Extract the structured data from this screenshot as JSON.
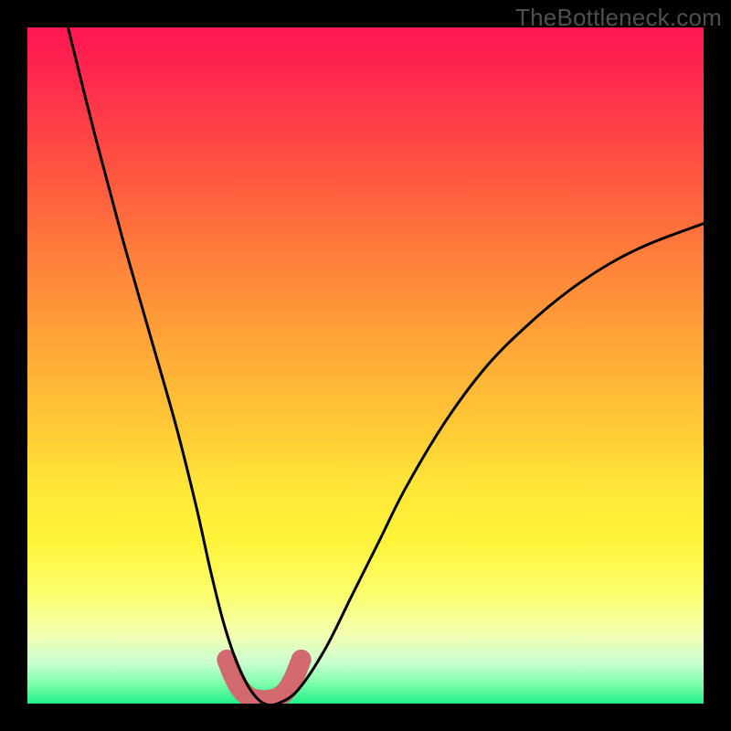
{
  "watermark": "TheBottleneck.com",
  "chart_data": {
    "type": "line",
    "title": "",
    "xlabel": "",
    "ylabel": "",
    "xlim": [
      0,
      100
    ],
    "ylim": [
      0,
      100
    ],
    "grid": false,
    "series": [
      {
        "name": "bottleneck-curve",
        "color": "#000000",
        "x": [
          6,
          10,
          14,
          18,
          22,
          25,
          27,
          29,
          31,
          33,
          35,
          37,
          40,
          44,
          48,
          52,
          56,
          62,
          68,
          74,
          80,
          86,
          92,
          100
        ],
        "values": [
          100,
          84,
          69,
          55,
          41,
          29,
          20,
          12,
          6,
          2,
          0,
          0,
          2,
          8,
          16,
          24,
          32,
          42,
          50,
          56,
          61,
          65,
          68,
          71
        ]
      }
    ],
    "highlight": {
      "name": "minimum-region",
      "color": "#d1696f",
      "x": [
        29.5,
        30.5,
        31.5,
        32.5,
        33.5,
        35,
        36.5,
        37.5,
        38.5,
        39.5,
        40.5
      ],
      "values": [
        6.5,
        4,
        2.2,
        1.2,
        0.7,
        0.5,
        0.7,
        1.2,
        2.2,
        4,
        6.5
      ]
    }
  }
}
